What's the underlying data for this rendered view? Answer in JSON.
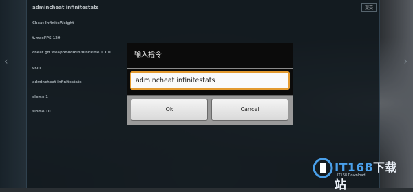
{
  "console": {
    "command_value": "admincheat infinitestats",
    "submit_label": "提交",
    "history": [
      "Cheat InfiniteWeight",
      "t.maxFPS 120",
      "cheat gfi WeaponAdminBlinkRifle 1 1 0",
      "gcm",
      "admincheat infinitestats",
      "slomo 1",
      "slomo 10"
    ]
  },
  "dialog": {
    "title": "输入指令",
    "input_value": "admincheat infinitestats",
    "ok_label": "Ok",
    "cancel_label": "Cancel"
  },
  "watermark": {
    "brand_main": "IT168",
    "brand_cn": "下载站",
    "sub": "IT168 Download"
  },
  "colors": {
    "accent": "#e39a2f",
    "brand_blue": "#4aa0ea"
  }
}
